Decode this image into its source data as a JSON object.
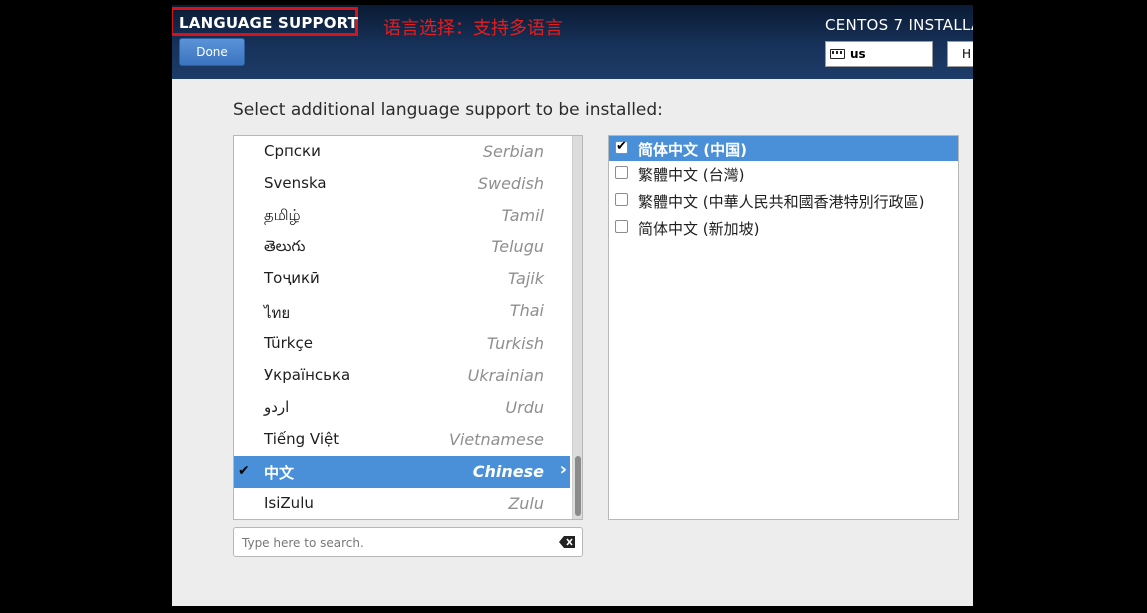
{
  "header": {
    "page_title": "LANGUAGE SUPPORT",
    "annotation": "语言选择：支持多语言",
    "done_label": "Done",
    "installer_title": "CENTOS 7 INSTALLA",
    "keyboard_layout": "us",
    "help_label": "H"
  },
  "main": {
    "prompt": "Select additional language support to be installed:"
  },
  "languages": [
    {
      "native": "Српски",
      "english": "Serbian"
    },
    {
      "native": "Svenska",
      "english": "Swedish"
    },
    {
      "native": "தமிழ்",
      "english": "Tamil"
    },
    {
      "native": "తెలుగు",
      "english": "Telugu"
    },
    {
      "native": "Тоҷикӣ",
      "english": "Tajik"
    },
    {
      "native": "ไทย",
      "english": "Thai"
    },
    {
      "native": "Türkçe",
      "english": "Turkish"
    },
    {
      "native": "Українська",
      "english": "Ukrainian"
    },
    {
      "native": "اردو",
      "english": "Urdu"
    },
    {
      "native": "Tiếng Việt",
      "english": "Vietnamese"
    },
    {
      "native": "中文",
      "english": "Chinese",
      "selected": true
    },
    {
      "native": "IsiZulu",
      "english": "Zulu"
    }
  ],
  "search": {
    "placeholder": "Type here to search."
  },
  "locales": [
    {
      "label": "简体中文 (中国)",
      "checked": true,
      "selected": true
    },
    {
      "label": "繁體中文 (台灣)",
      "checked": false
    },
    {
      "label": "繁體中文 (中華人民共和國香港特別行政區)",
      "checked": false
    },
    {
      "label": "简体中文 (新加坡)",
      "checked": false
    }
  ],
  "colors": {
    "selection": "#4a90d9",
    "annotation_red": "#d6121b",
    "header_dark": "#0a1a33"
  },
  "icons": {
    "keyboard": "keyboard-icon",
    "check": "checkmark-icon",
    "chevron": "chevron-right-icon",
    "clear": "clear-search-icon"
  }
}
